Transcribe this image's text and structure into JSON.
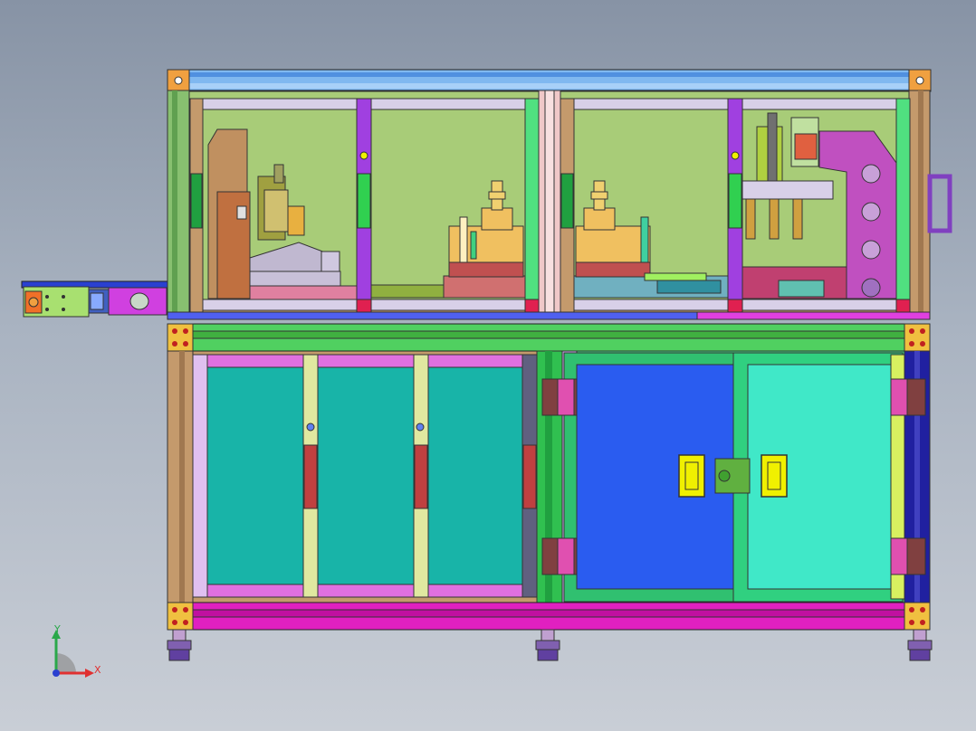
{
  "view": {
    "background_top": "#8793a5",
    "background_bottom": "#c9ced6"
  },
  "triad": {
    "x_label": "X",
    "y_label": "Y",
    "x_color": "#e03030",
    "y_color": "#2aa84a",
    "z_color": "#2a40d0"
  },
  "colors": {
    "frame_orange": "#f0a040",
    "frame_tan": "#c49a6c",
    "frame_blue": "#5a8fe0",
    "panel_green": "#a8cc78",
    "green_bright": "#40d860",
    "purple": "#a040e0",
    "magenta": "#e020c0",
    "teal": "#18b4a8",
    "blue_door": "#2a5cf0",
    "aqua_door": "#40e8c8",
    "yellow": "#f0f000",
    "navy": "#2020a0"
  }
}
